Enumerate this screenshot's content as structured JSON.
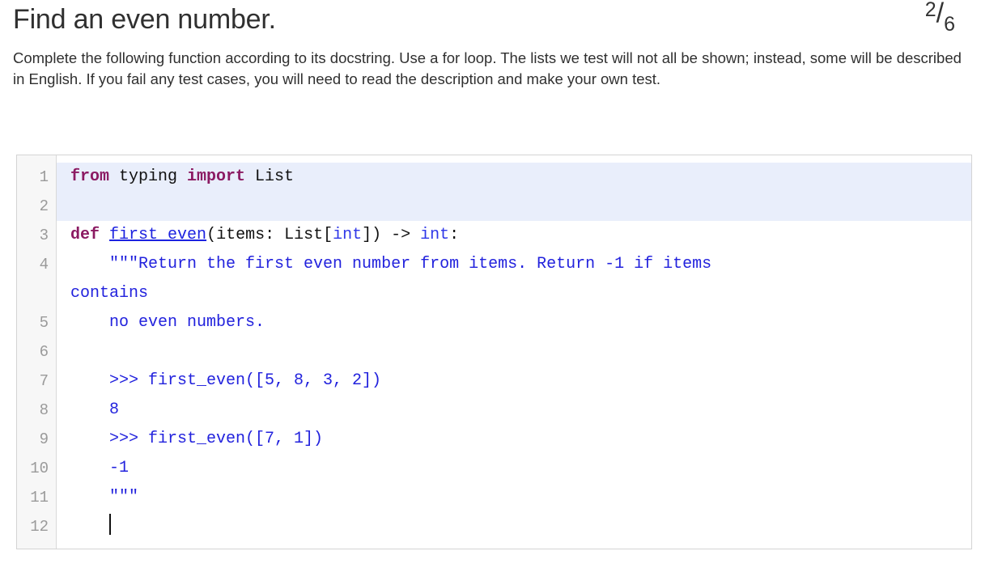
{
  "header": {
    "title": "Find an even number.",
    "counter": {
      "numerator": "2",
      "separator": "/",
      "denominator": "6"
    },
    "description": "Complete the following function according to its docstring. Use a for loop. The lists we test will not all be shown; instead, some will be described in English. If you fail any test cases, you will need to read the description and make your own test."
  },
  "editor": {
    "line_numbers": [
      "1",
      "2",
      "3",
      "4",
      "",
      "5",
      "6",
      "7",
      "8",
      "9",
      "10",
      "11",
      "12"
    ],
    "lines": [
      {
        "n": "1",
        "readonly": true,
        "wrapped": false,
        "tokens": [
          {
            "t": "from",
            "c": "kw"
          },
          {
            "t": " typing ",
            "c": "plain"
          },
          {
            "t": "import",
            "c": "kw"
          },
          {
            "t": " List",
            "c": "plain"
          }
        ]
      },
      {
        "n": "2",
        "readonly": true,
        "wrapped": false,
        "tokens": []
      },
      {
        "n": "3",
        "readonly": false,
        "wrapped": false,
        "tokens": [
          {
            "t": "def",
            "c": "kw"
          },
          {
            "t": " ",
            "c": "plain"
          },
          {
            "t": "first_even",
            "c": "fname"
          },
          {
            "t": "(items: List[",
            "c": "plain"
          },
          {
            "t": "int",
            "c": "builtin"
          },
          {
            "t": "]) -> ",
            "c": "plain"
          },
          {
            "t": "int",
            "c": "builtin"
          },
          {
            "t": ":",
            "c": "plain"
          }
        ]
      },
      {
        "n": "4",
        "readonly": false,
        "wrapped": false,
        "tokens": [
          {
            "t": "    \"\"\"Return the first even number from items. Return -1 if items",
            "c": "str"
          }
        ]
      },
      {
        "n": "",
        "readonly": false,
        "wrapped": true,
        "tokens": [
          {
            "t": "contains",
            "c": "str"
          }
        ]
      },
      {
        "n": "5",
        "readonly": false,
        "wrapped": false,
        "tokens": [
          {
            "t": "    no even numbers.",
            "c": "str"
          }
        ]
      },
      {
        "n": "6",
        "readonly": false,
        "wrapped": false,
        "tokens": []
      },
      {
        "n": "7",
        "readonly": false,
        "wrapped": false,
        "tokens": [
          {
            "t": "    >>> first_even([5, 8, 3, 2])",
            "c": "str"
          }
        ]
      },
      {
        "n": "8",
        "readonly": false,
        "wrapped": false,
        "tokens": [
          {
            "t": "    8",
            "c": "str"
          }
        ]
      },
      {
        "n": "9",
        "readonly": false,
        "wrapped": false,
        "tokens": [
          {
            "t": "    >>> first_even([7, 1])",
            "c": "str"
          }
        ]
      },
      {
        "n": "10",
        "readonly": false,
        "wrapped": false,
        "tokens": [
          {
            "t": "    -1",
            "c": "str"
          }
        ]
      },
      {
        "n": "11",
        "readonly": false,
        "wrapped": false,
        "tokens": [
          {
            "t": "    \"\"\"",
            "c": "str"
          }
        ]
      },
      {
        "n": "12",
        "readonly": false,
        "wrapped": false,
        "caret": true,
        "tokens": [
          {
            "t": "    ",
            "c": "plain"
          }
        ]
      }
    ]
  },
  "colors": {
    "keyword": "#8b1a62",
    "function_name": "#1c22e0",
    "builtin": "#2f38e8",
    "string": "#2222dd",
    "readonly_background": "#e9eefb",
    "gutter_background": "#f7f7f7",
    "line_number": "#9a9a9a",
    "text": "#303030",
    "border": "#d4d4d4"
  }
}
